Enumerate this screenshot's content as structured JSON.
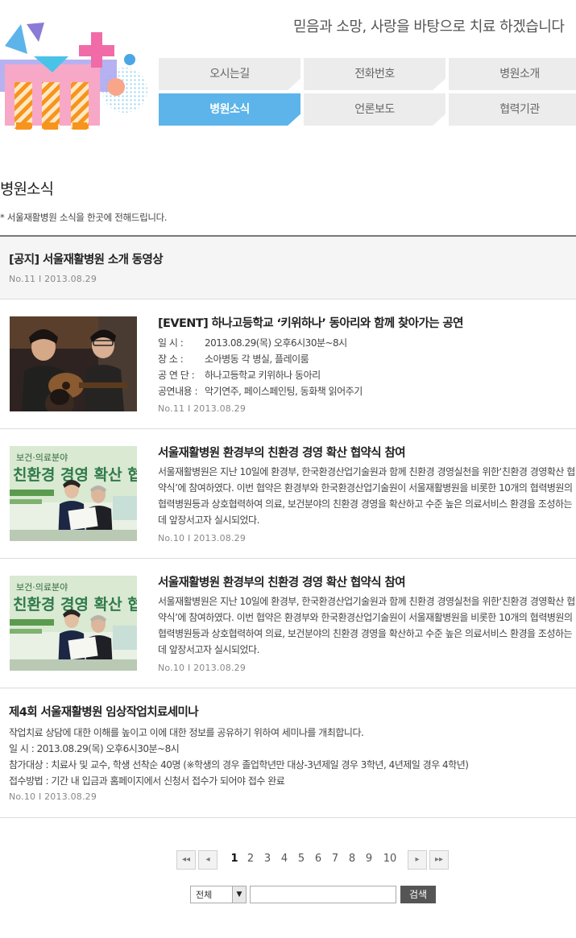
{
  "header": {
    "slogan": "믿음과 소망, 사랑을 바탕으로 치료 하겠습니다"
  },
  "nav": {
    "items": [
      {
        "label": "오시는길",
        "active": false
      },
      {
        "label": "전화번호",
        "active": false
      },
      {
        "label": "병원소개",
        "active": false
      },
      {
        "label": "병원소식",
        "active": true
      },
      {
        "label": "언론보도",
        "active": false
      },
      {
        "label": "협력기관",
        "active": false
      }
    ]
  },
  "page": {
    "title": "병원소식",
    "description": "* 서울재활병원 소식을 한곳에 전해드립니다."
  },
  "posts": [
    {
      "title": "[공지] 서울재활병원 소개 동영상",
      "meta": "No.11  I  2013.08.29"
    },
    {
      "title": "[EVENT] 하나고등학교 ‘키위하나’ 동아리와 함께 찾아가는 공연",
      "info": [
        {
          "label": "일      시 :",
          "value": "2013.08.29(목) 오후6시30분~8시"
        },
        {
          "label": "장      소 :",
          "value": "소아병동 각 병실, 플레이룸"
        },
        {
          "label": "공 연 단 :",
          "value": "하나고등학교 키위하나 동아리"
        },
        {
          "label": "공연내용 :",
          "value": "악기연주, 페이스페인팅, 동화책 읽어주기"
        }
      ],
      "meta": "No.11  I  2013.08.29"
    },
    {
      "title": "서울재활병원 환경부의 친환경 경영 확산 협약식 참여",
      "body": "서울재활병원은 지난 10일에 환경부, 한국환경산업기술원과 함께 친환경 경영실천을 위한‘친환경 경영확산 협약식’에 참여하였다. 이번 협약은 환경부와 한국환경산업기술원이 서울재활병원을 비롯한 10개의 협력병원의 협력병원등과 상호협력하여 의료, 보건분야의 친환경 경영을 확산하고 수준 높은 의료서비스 환경을 조성하는데 앞장서고자 실시되었다.",
      "meta": "No.10  I  2013.08.29",
      "banner_top": "보건·의료분야",
      "banner_main": "친환경 경영 확산 협약식"
    },
    {
      "title": "서울재활병원 환경부의 친환경 경영 확산 협약식 참여",
      "body": "서울재활병원은 지난 10일에 환경부, 한국환경산업기술원과 함께 친환경 경영실천을 위한‘친환경 경영확산 협약식’에 참여하였다. 이번 협약은 환경부와 한국환경산업기술원이 서울재활병원을 비롯한 10개의 협력병원의 협력병원등과 상호협력하여 의료, 보건분야의 친환경 경영을 확산하고 수준 높은 의료서비스 환경을 조성하는데 앞장서고자 실시되었다.",
      "meta": "No.10  I  2013.08.29",
      "banner_top": "보건·의료분야",
      "banner_main": "친환경 경영 확산 협약식"
    },
    {
      "title": "제4회 서울재활병원 임상작업치료세미나",
      "lines": [
        "작업치료 상담에 대한 이해를 높이고 이에 대한 정보를 공유하기 위하여 세미나를 개최합니다.",
        "일      시 :  2013.08.29(목) 오후6시30분~8시",
        "참가대상 :  치료사 및 교수, 학생 선착순 40명 (※학생의 경우 졸업학년만 대상-3년제일 경우 3학년, 4년제일 경우 4학년)",
        "접수방법 : 기간 내 입금과 홈페이지에서 신청서 접수가 되어야 접수 완료"
      ],
      "meta": "No.10  I  2013.08.29"
    }
  ],
  "pagination": {
    "first_icon": "double-chevron-left-icon",
    "prev_icon": "chevron-left-icon",
    "next_icon": "chevron-right-icon",
    "last_icon": "double-chevron-right-icon",
    "first": "◂◂",
    "prev": "◂",
    "next": "▸",
    "last": "▸▸",
    "pages": [
      "1",
      "2",
      "3",
      "4",
      "5",
      "6",
      "7",
      "8",
      "9",
      "10"
    ],
    "current": "1"
  },
  "search": {
    "select_value": "전체",
    "select_icon": "dropdown-arrow-icon",
    "select_arrow": "▼",
    "input_value": "",
    "button_label": "검색"
  },
  "colors": {
    "accent": "#5cb4ea",
    "nav_bg": "#ececec",
    "logo_orange": "#f7941d",
    "logo_pink": "#f06ba8",
    "logo_purple": "#8a7bd6"
  }
}
